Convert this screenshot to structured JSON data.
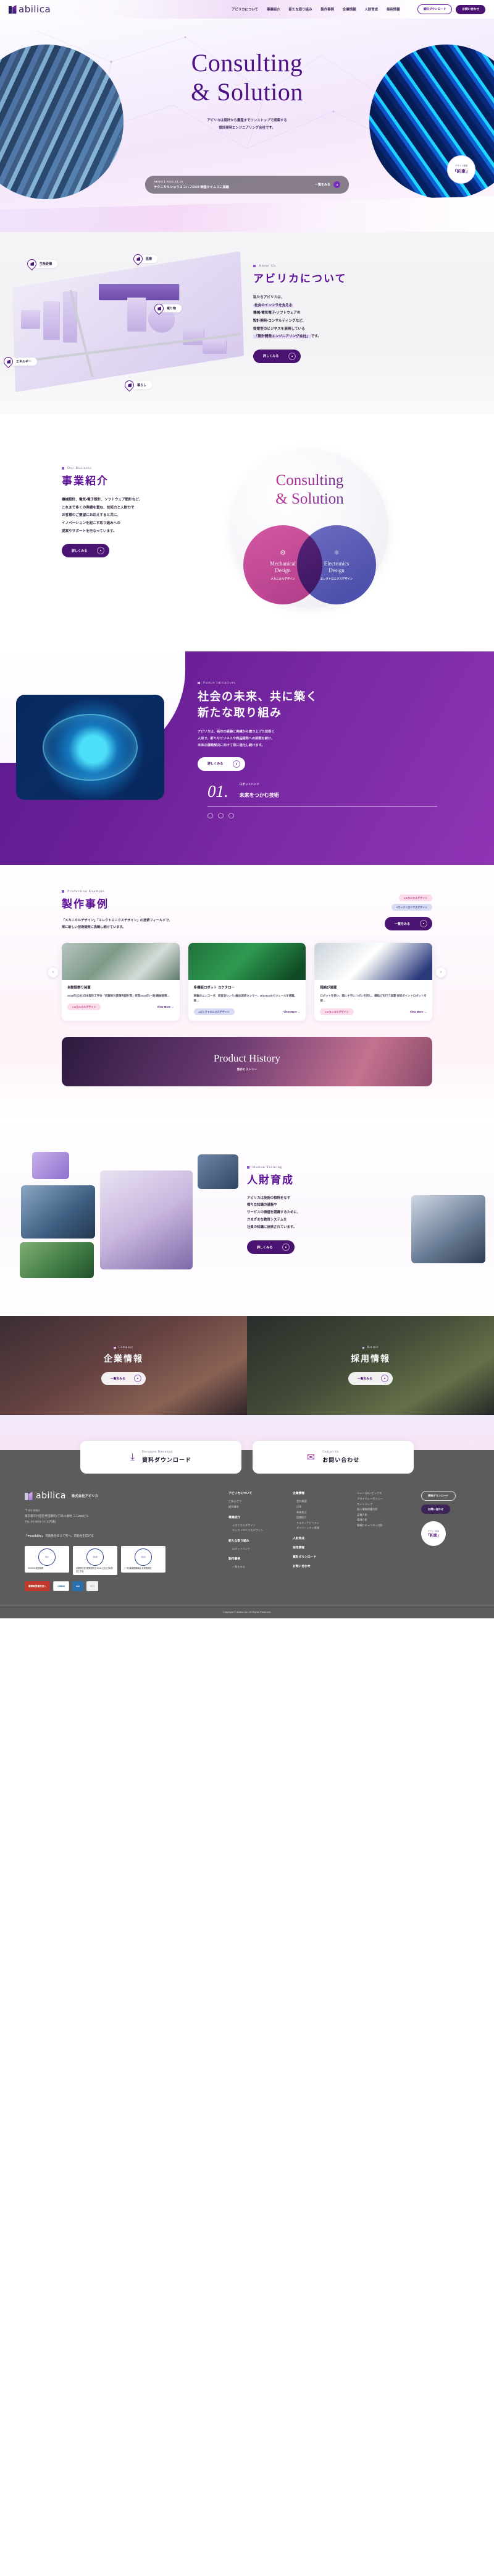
{
  "header": {
    "logo_text": "abilica",
    "nav": [
      {
        "label": "アビリカについて"
      },
      {
        "label": "事業紹介"
      },
      {
        "label": "新たな取り組み"
      },
      {
        "label": "製作事例"
      },
      {
        "label": "企業情報"
      },
      {
        "label": "人財育成"
      },
      {
        "label": "採用情報"
      }
    ],
    "btn_download": "資料ダウンロード",
    "btn_contact": "お問い合わせ"
  },
  "hero": {
    "title_line1": "Consulting",
    "title_line2": "& Solution",
    "desc_line1": "アビリカは設計から量産までワンストップで提案する",
    "desc_line2": "設計開発エンジニアリング会社です。",
    "news_meta": "NEWS  |  2024.03.19",
    "news_title": "テクニカルショウヨコハマ2024  帝国タイムスに掲載",
    "news_more": "一覧をみる",
    "badge_top": "デザイン経営",
    "badge_main": "「約束」"
  },
  "about": {
    "eyebrow": "About Us",
    "title": "アビリカについて",
    "body_1": "私たちアビリカは、",
    "body_hl1": "社会のインフラを支える",
    "body_2": "機械・電気電子・ソフトウェアの",
    "body_3": "設計開発・コンサルティングなど、",
    "body_4": "提案型のビジネスを展開している",
    "body_hl2": "「設計開発エンジニアリング会社」",
    "body_5": "です。",
    "button": "詳しくみる",
    "pins": [
      {
        "label": "生産設備"
      },
      {
        "label": "医療"
      },
      {
        "label": "乗り物"
      },
      {
        "label": "エネルギー"
      },
      {
        "label": "暮らし"
      }
    ]
  },
  "business": {
    "eyebrow": "Our Business",
    "title": "事業紹介",
    "body_1": "機械設計、電気・電子設計、ソフトウェア設計など、",
    "body_2": "これまで多くの実績を重ね、技術力と人財力で",
    "body_3": "お客様のご要望にお応えすると共に、",
    "body_4": "イノベーションを起こす取り組みへの",
    "body_5": "提案やサポートを行なっています。",
    "button": "詳しくみる",
    "venn": {
      "head_1": "Consulting",
      "head_2": "& Solution",
      "left_en_1": "Mechanical",
      "left_en_2": "Design",
      "left_jp": "メカニカルデザイン",
      "left_icon": "gears-icon",
      "right_en_1": "Electronics",
      "right_en_2": "Design",
      "right_jp": "エレクトロニクスデザイン",
      "right_icon": "circuit-gear-icon"
    }
  },
  "future": {
    "eyebrow": "Future Initiatives",
    "title_1": "社会の未来、共に築く",
    "title_2": "新たな取り組み",
    "body_1": "アビリカは、長年の経験と実績から磨き上げた技術と",
    "body_2": "人財で、新たなビジネスや商品開発への挑戦を続け、",
    "body_3": "未来の課題解決に向けて常に進化し続けます。",
    "button": "詳しくみる",
    "item_num": "01.",
    "item_cat": "ロボットハンド",
    "item_title": "未来をつかむ技術"
  },
  "products": {
    "eyebrow": "Production Example",
    "title": "製作事例",
    "body_1": "「メカニカルデザイン」「エレクトロニクスデザイン」の技術フィールドで、",
    "body_2": "常に新しい技術開発に挑戦し続けています。",
    "tag_mech": "#メカニカルデザイン",
    "tag_elec": "#エレクトロニクスデザイン",
    "list_button": "一覧をみる",
    "view_more": "View More →",
    "prev_icon": "chevron-left-icon",
    "next_icon": "chevron-right-icon",
    "cards": [
      {
        "title": "自動瓶飾り装置",
        "desc": "2018年(公社)日本設計工学会「武藤栄次賞優秀設計賞」受賞2023年(一財)機械振興…",
        "tag": "#メカニカルデザイン",
        "tag_type": "pink"
      },
      {
        "title": "多機能ロボット  ヨケタロー",
        "desc": "車輪のエンコーダ、超音波センサ3軸加速度センサー、Bluetoothモジュールを搭載。車…",
        "tag": "#エレクトロニクスデザイン",
        "tag_type": "blue"
      },
      {
        "title": "箱結び装置",
        "desc": "ロボットを使い、箱に十字にリボンを回し、蝶結びを行う装置 技術ポイントロボットを使…",
        "tag": "#メカニカルデザイン",
        "tag_type": "pink"
      }
    ],
    "history_title": "Product History",
    "history_sub": "製作ヒストリー"
  },
  "hr": {
    "eyebrow": "Human Training",
    "title": "人財育成",
    "body_1": "アビリカは技術の根幹をなす",
    "body_2": "様々な知識の基盤や",
    "body_3": "サービスの価値を認識するために、",
    "body_4": "さまざまな教育システムを",
    "body_5": "社員の知識に反映されています。",
    "button": "詳しくみる"
  },
  "two_cards": [
    {
      "eyebrow": "Company",
      "title": "企業情報",
      "button": "一覧をみる"
    },
    {
      "eyebrow": "Recruit",
      "title": "採用情報",
      "button": "一覧をみる"
    }
  ],
  "cta": [
    {
      "en": "Document Download",
      "jp": "資料ダウンロード",
      "icon": "download-tray-icon"
    },
    {
      "en": "Contact Us",
      "jp": "お問い合わせ",
      "icon": "mail-icon"
    }
  ],
  "footer": {
    "logo_text": "abilica",
    "corp_name": "株式会社アビリカ",
    "addr_1": "〒101-0054",
    "addr_2": "東京都千代田区神田錦町3丁目21番地 ココ202ビル",
    "addr_3": "TEL:03-6803-1013(代表)",
    "poss_title": "「Possibility」",
    "poss_body": "可能性を信じて先へ。可能性を広げる",
    "certs": [
      {
        "seal": "ISO",
        "text": "ISO9001認証取得"
      },
      {
        "seal": "2018",
        "text": "武藤栄次賞 優秀設計賞 2018\n(公社)日本設計工学会"
      },
      {
        "seal": "2023",
        "text": "(一財)機械振興協会\n技術振興賞"
      }
    ],
    "banners": [
      {
        "label": "健康経営優良法人"
      },
      {
        "label": "J-MDIA"
      },
      {
        "label": "eee"
      },
      {
        "label": "□□□"
      }
    ],
    "columns": [
      {
        "title": "アビリカについて",
        "items": [
          {
            "label": "ごあいさつ",
            "sub": false
          },
          {
            "label": "経営理念",
            "sub": false
          }
        ]
      },
      {
        "title": "事業紹介",
        "items": [
          {
            "label": "メカニカルデザイン",
            "sub": true
          },
          {
            "label": "エレクトロニクスデザイン",
            "sub": true
          }
        ]
      },
      {
        "title": "新たな取り組み",
        "items": [
          {
            "label": "ロボットハンド",
            "sub": true
          }
        ]
      },
      {
        "title": "製作事例",
        "items": [
          {
            "label": "一覧をみる",
            "sub": true
          }
        ]
      },
      {
        "title": "企業情報",
        "items": [
          {
            "label": "会社概要",
            "sub": true
          },
          {
            "label": "沿革",
            "sub": true
          },
          {
            "label": "事業拠点",
            "sub": true
          },
          {
            "label": "設備紹介",
            "sub": true
          },
          {
            "label": "サスティナビリティ",
            "sub": true
          },
          {
            "label": "ダイバーシティ推進",
            "sub": true
          }
        ]
      },
      {
        "title": "人財育成",
        "items": []
      },
      {
        "title": "採用情報",
        "items": []
      },
      {
        "title": "資料ダウンロード",
        "items": []
      },
      {
        "title": "お問い合わせ",
        "items": []
      }
    ],
    "right_links": [
      {
        "label": "ニュース&トピックス"
      },
      {
        "label": "プライバシーポリシー"
      },
      {
        "label": "サイトマップ"
      },
      {
        "label": "個人情報保護方針"
      },
      {
        "label": "品質方針"
      },
      {
        "label": "環境方針"
      },
      {
        "label": "情報セキュリティ方針"
      }
    ],
    "btn_download": "資料ダウンロード",
    "btn_contact": "お問い合わせ",
    "badge_top": "デザイン経営",
    "badge_main": "「約束」",
    "copyright": "Copyright © abilica Inc. All Rights Reserved."
  }
}
